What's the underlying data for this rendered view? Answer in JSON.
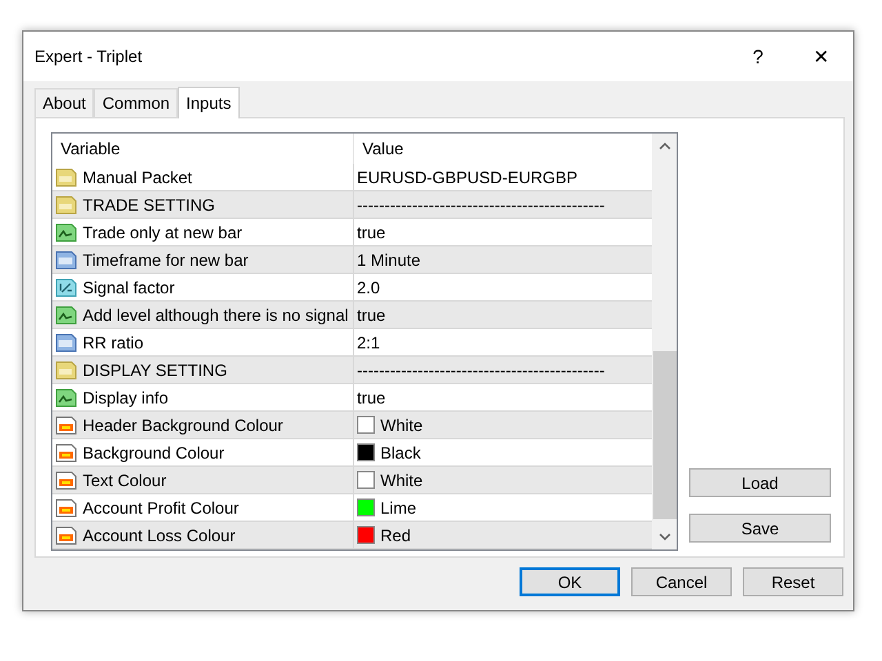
{
  "window": {
    "title": "Expert - Triplet",
    "help": "?",
    "close": "✕"
  },
  "tabs": [
    {
      "label": "About",
      "selected": false
    },
    {
      "label": "Common",
      "selected": false
    },
    {
      "label": "Inputs",
      "selected": true
    }
  ],
  "table": {
    "columns": [
      "Variable",
      "Value"
    ],
    "rows": [
      {
        "kind": "string",
        "variable": "Manual Packet",
        "value": "EURUSD-GBPUSD-EURGBP"
      },
      {
        "kind": "string",
        "variable": "TRADE SETTING",
        "value": "---------------------------------------------"
      },
      {
        "kind": "bool",
        "variable": "Trade only at new bar",
        "value": "true"
      },
      {
        "kind": "int",
        "variable": "Timeframe for new bar",
        "value": "1 Minute"
      },
      {
        "kind": "double",
        "variable": "Signal factor",
        "value": "2.0"
      },
      {
        "kind": "bool",
        "variable": "Add level although there is no signal",
        "value": "true"
      },
      {
        "kind": "int",
        "variable": "RR ratio",
        "value": "2:1"
      },
      {
        "kind": "string",
        "variable": "DISPLAY SETTING",
        "value": "---------------------------------------------"
      },
      {
        "kind": "bool",
        "variable": "Display info",
        "value": "true"
      },
      {
        "kind": "color",
        "variable": "Header Background Colour",
        "value": "White",
        "color": "#ffffff"
      },
      {
        "kind": "color",
        "variable": "Background Colour",
        "value": "Black",
        "color": "#000000"
      },
      {
        "kind": "color",
        "variable": "Text Colour",
        "value": "White",
        "color": "#ffffff"
      },
      {
        "kind": "color",
        "variable": "Account Profit Colour",
        "value": "Lime",
        "color": "#00ff00"
      },
      {
        "kind": "color",
        "variable": "Account Loss Colour",
        "value": "Red",
        "color": "#ff0000"
      }
    ]
  },
  "side_buttons": [
    "Load",
    "Save"
  ],
  "buttons": [
    {
      "label": "OK",
      "default": true
    },
    {
      "label": "Cancel",
      "default": false
    },
    {
      "label": "Reset",
      "default": false
    }
  ]
}
